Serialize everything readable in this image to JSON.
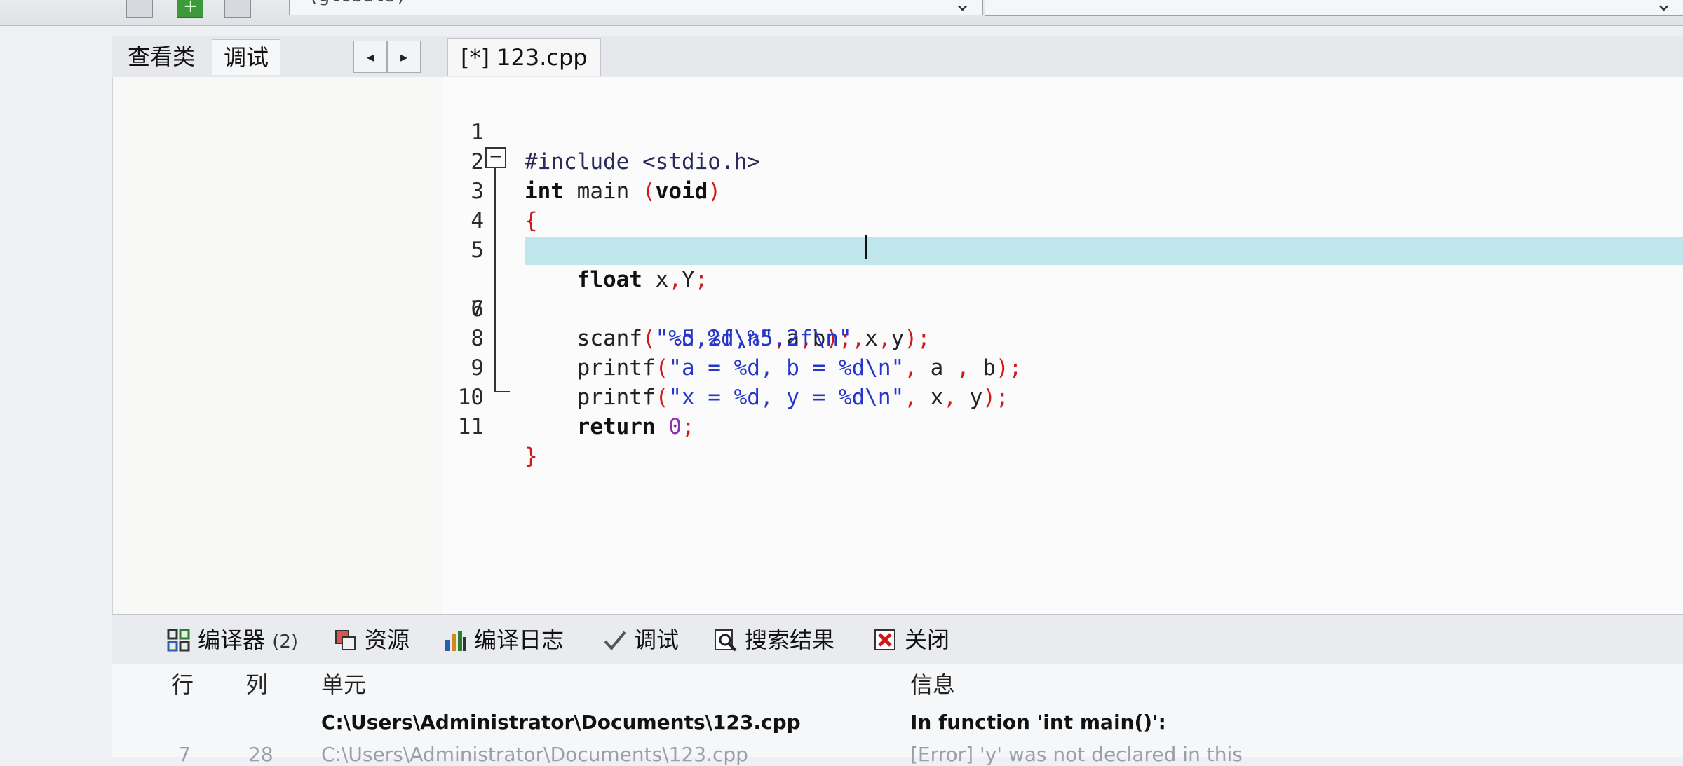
{
  "toolbar": {
    "scope_select": "(globals)"
  },
  "left_panel": {
    "tabs": [
      "查看类",
      "调试"
    ],
    "nav_left": "◂",
    "nav_right": "▸"
  },
  "editor": {
    "file_tab": "[*] 123.cpp",
    "fold_symbol": "−",
    "line_numbers": [
      "1",
      "2",
      "3",
      "4",
      "5",
      "6",
      "7",
      "8",
      "9",
      "10",
      "11"
    ],
    "highlighted_line": "6"
  },
  "bottom_panel": {
    "tabs": {
      "compiler": "编译器",
      "compiler_count": "(2)",
      "resources": "资源",
      "compile_log": "编译日志",
      "debug": "调试",
      "search_results": "搜索结果",
      "close": "关闭"
    },
    "columns": {
      "line": "行",
      "col": "列",
      "unit": "单元",
      "info": "信息"
    },
    "messages": [
      {
        "line": "",
        "col": "",
        "unit": "C:\\Users\\Administrator\\Documents\\123.cpp",
        "info": "In function 'int main()':"
      },
      {
        "line": "7",
        "col": "28",
        "unit": "C:\\Users\\Administrator\\Documents\\123.cpp",
        "info": "[Error] 'y' was not declared in this"
      }
    ]
  },
  "colors": {
    "keyword": "#111111",
    "string": "#2536c8",
    "punctuation": "#d01818",
    "number": "#8a2fb0",
    "highlight_line": "#bfe6ea"
  }
}
